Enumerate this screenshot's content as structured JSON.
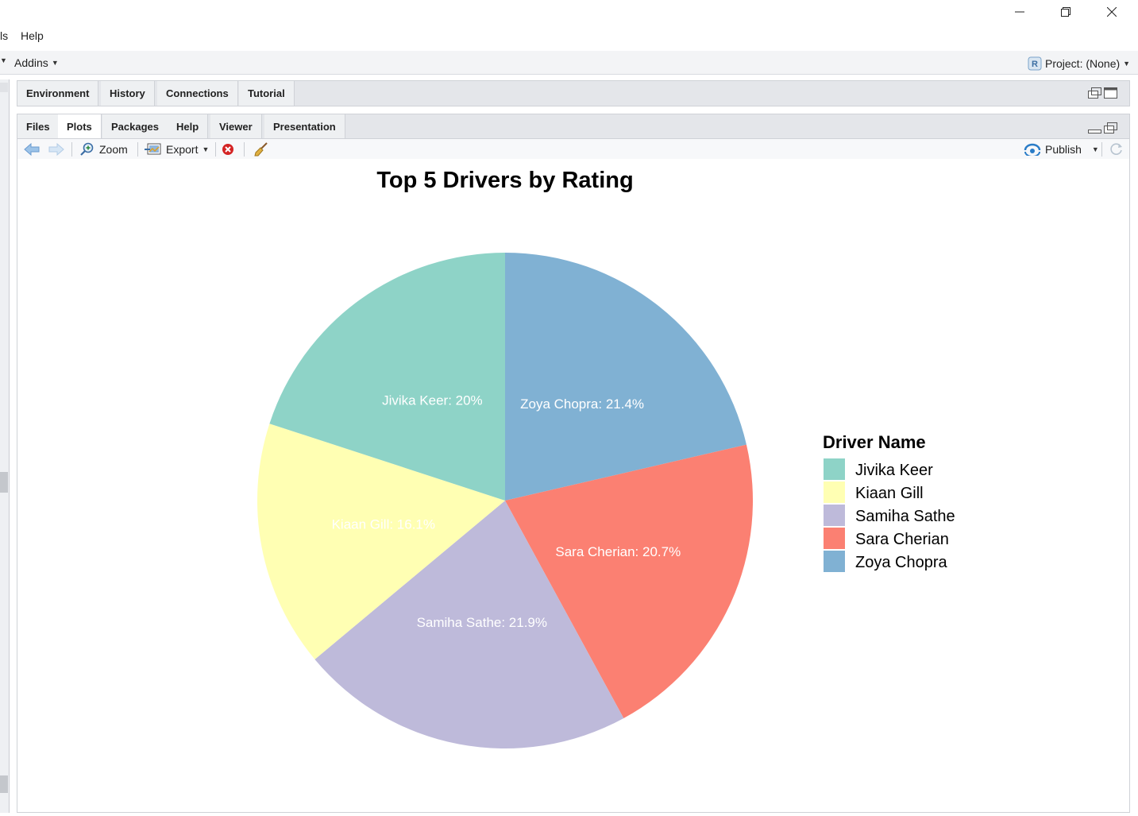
{
  "menubar": {
    "tools_fragment": "ls",
    "help": "Help"
  },
  "toolbar": {
    "addins": "Addins",
    "project": "Project: (None)"
  },
  "top_tabs": [
    {
      "label": "Environment"
    },
    {
      "label": "History"
    },
    {
      "label": "Connections"
    },
    {
      "label": "Tutorial"
    }
  ],
  "bottom_tabs": [
    {
      "label": "Files",
      "active": false
    },
    {
      "label": "Plots",
      "active": true
    },
    {
      "label": "Packages",
      "active": false
    },
    {
      "label": "Help",
      "active": false
    },
    {
      "label": "Viewer",
      "active": false
    },
    {
      "label": "Presentation",
      "active": false
    }
  ],
  "plot_tools": {
    "zoom": "Zoom",
    "export": "Export",
    "publish": "Publish"
  },
  "icons": [
    "back-arrow-icon",
    "forward-arrow-icon",
    "zoom-icon",
    "export-icon",
    "remove-plot-icon",
    "broom-icon",
    "publish-icon",
    "refresh-icon",
    "minimize-pane-icon",
    "maximize-pane-icon"
  ],
  "chart_data": {
    "type": "pie",
    "title": "Top 5 Drivers by Rating",
    "legend_title": "Driver Name",
    "legend_position": "right",
    "categories": [
      "Jivika Keer",
      "Kiaan Gill",
      "Samiha Sathe",
      "Sara Cherian",
      "Zoya Chopra"
    ],
    "values": [
      20.0,
      16.1,
      21.9,
      20.7,
      21.4
    ],
    "slice_labels": [
      "Jivika Keer: 20%",
      "Kiaan Gill: 16.1%",
      "Samiha Sathe: 21.9%",
      "Sara Cherian: 20.7%",
      "Zoya Chopra: 21.4%"
    ],
    "colors": [
      "#8ED3C7",
      "#FFFFB3",
      "#BEBADA",
      "#FB8072",
      "#80B1D3"
    ],
    "draw_order": [
      "Zoya Chopra",
      "Sara Cherian",
      "Samiha Sathe",
      "Kiaan Gill",
      "Jivika Keer"
    ],
    "direction": "clockwise_from_top"
  }
}
